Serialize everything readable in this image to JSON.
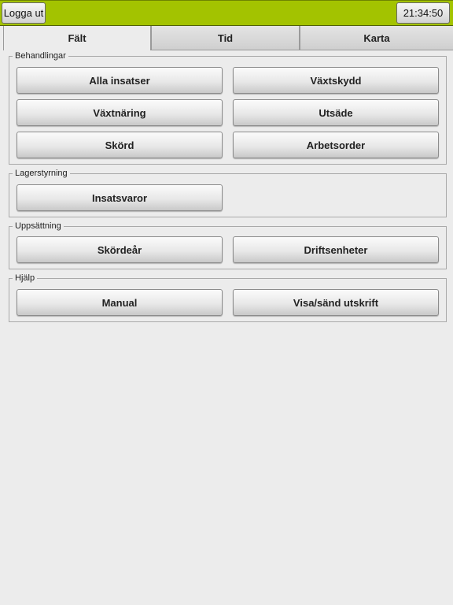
{
  "topbar": {
    "logout_label": "Logga ut",
    "clock": "21:34:50",
    "accent_color": "#a3c300"
  },
  "tabs": [
    {
      "label": "Fält",
      "active": true
    },
    {
      "label": "Tid",
      "active": false
    },
    {
      "label": "Karta",
      "active": false
    }
  ],
  "groups": {
    "behandlingar": {
      "title": "Behandlingar",
      "buttons": [
        "Alla insatser",
        "Växtskydd",
        "Växtnäring",
        "Utsäde",
        "Skörd",
        "Arbetsorder"
      ]
    },
    "lagerstyrning": {
      "title": "Lagerstyrning",
      "buttons": [
        "Insatsvaror"
      ]
    },
    "uppsattning": {
      "title": "Uppsättning",
      "buttons": [
        "Skördeår",
        "Driftsenheter"
      ]
    },
    "hjalp": {
      "title": "Hjälp",
      "buttons": [
        "Manual",
        "Visa/sänd utskrift"
      ]
    }
  }
}
